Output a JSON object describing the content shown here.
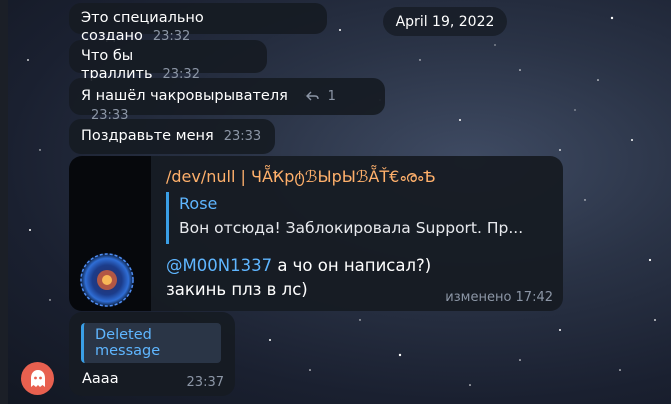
{
  "date_badge": "April 19, 2022",
  "messages": [
    {
      "text": "Это специально создано",
      "time": "23:32"
    },
    {
      "text": "Что бы траллить",
      "time": "23:32"
    },
    {
      "text": "Я нашёл чакровырывателя",
      "replies": "1",
      "time": "23:33"
    },
    {
      "text": "Поздравьте меня",
      "time": "23:33"
    }
  ],
  "card": {
    "title": "/dev/null | ЧẴҞрტℬЫрЫℬẴŤ€ൟѢ",
    "quote_author": "Rose",
    "quote_text": "Вон отсюда! Заблокировала Support. Пр...",
    "mention": "@M00N1337",
    "text_part1": " а чо он написал?)",
    "text_part2": "закинь плз в лс)",
    "edited": "изменено 17:42"
  },
  "deleted": {
    "label": "Deleted message",
    "text": "Aaaa",
    "time": "23:37"
  },
  "icons": {
    "reply": "reply-arrow-icon",
    "avatar": "ghost-icon"
  },
  "colors": {
    "accent": "#5fb6ff",
    "title": "#ffb06b",
    "avatar": "#e8604f"
  }
}
